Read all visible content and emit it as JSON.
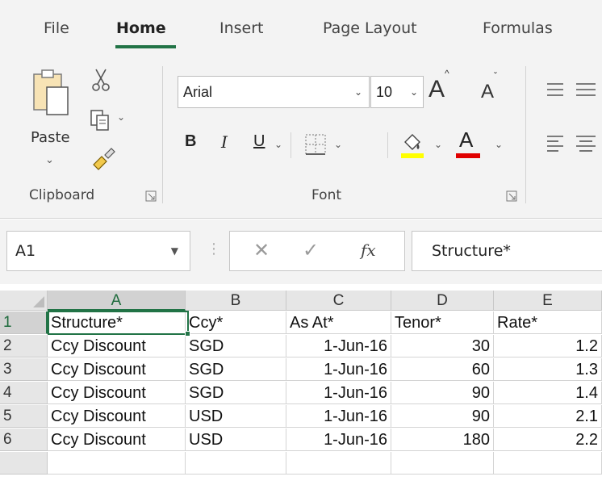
{
  "ribbon": {
    "tabs": [
      {
        "label": "File",
        "active": false
      },
      {
        "label": "Home",
        "active": true
      },
      {
        "label": "Insert",
        "active": false
      },
      {
        "label": "Page Layout",
        "active": false
      },
      {
        "label": "Formulas",
        "active": false
      }
    ],
    "clipboard": {
      "group_label": "Clipboard",
      "paste_label": "Paste"
    },
    "font": {
      "group_label": "Font",
      "font_name": "Arial",
      "font_size": "10",
      "bold": "B",
      "italic": "I",
      "underline": "U",
      "grow_glyph": "A",
      "shrink_glyph": "A",
      "font_color_glyph": "A"
    }
  },
  "formula_bar": {
    "name_box": "A1",
    "fx": "fx",
    "value": "Structure*"
  },
  "sheet": {
    "columns": [
      "A",
      "B",
      "C",
      "D",
      "E"
    ],
    "selected_cell": "A1",
    "rows": [
      {
        "row": "1",
        "cells": [
          "Structure*",
          "Ccy*",
          "As At*",
          "Tenor*",
          "Rate*"
        ]
      },
      {
        "row": "2",
        "cells": [
          "Ccy Discount",
          "SGD",
          "1-Jun-16",
          "30",
          "1.2"
        ]
      },
      {
        "row": "3",
        "cells": [
          "Ccy Discount",
          "SGD",
          "1-Jun-16",
          "60",
          "1.3"
        ]
      },
      {
        "row": "4",
        "cells": [
          "Ccy Discount",
          "SGD",
          "1-Jun-16",
          "90",
          "1.4"
        ]
      },
      {
        "row": "5",
        "cells": [
          "Ccy Discount",
          "USD",
          "1-Jun-16",
          "90",
          "2.1"
        ]
      },
      {
        "row": "6",
        "cells": [
          "Ccy Discount",
          "USD",
          "1-Jun-16",
          "180",
          "2.2"
        ]
      }
    ]
  },
  "colors": {
    "accent": "#217346",
    "highlight_yellow": "#ffff00",
    "font_red": "#e00000"
  }
}
